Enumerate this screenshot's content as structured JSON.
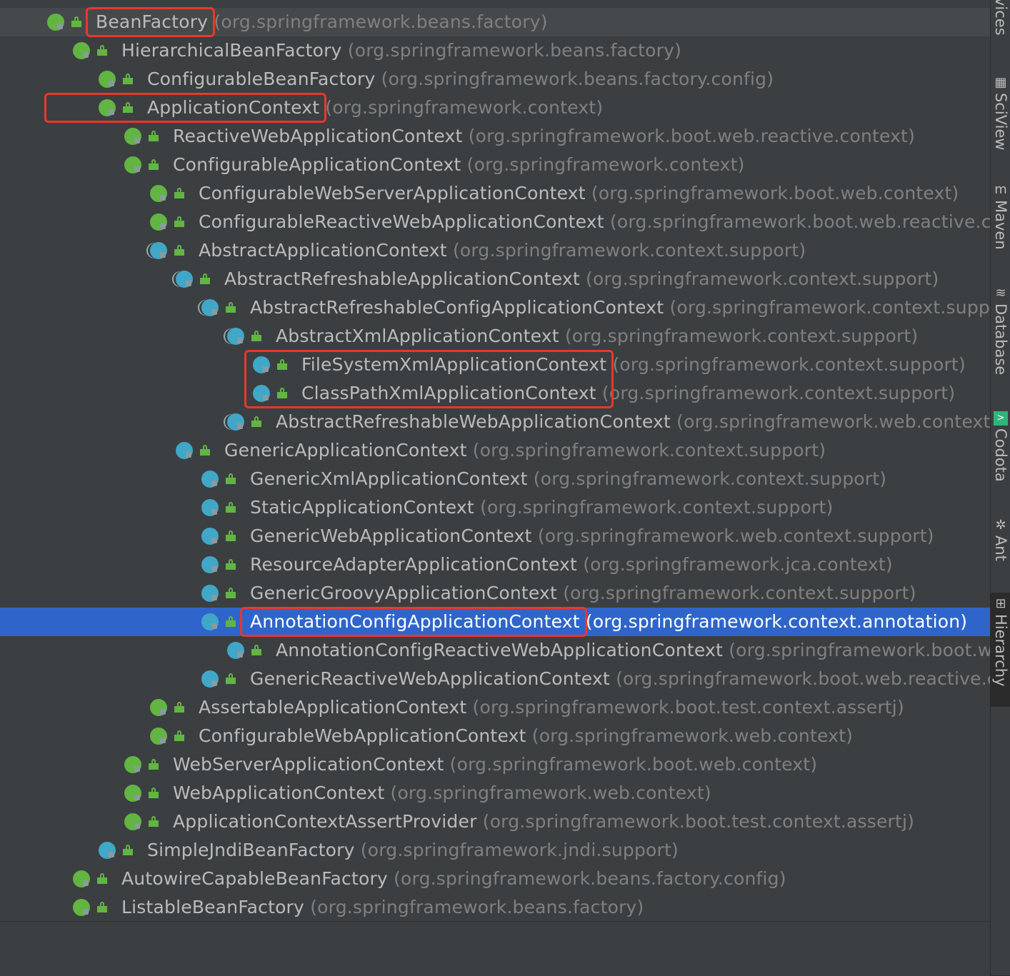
{
  "tree": [
    {
      "depth": 0,
      "arrow": "▼",
      "star": "*",
      "kind": "i",
      "name": "BeanFactory",
      "pkg": "(org.springframework.beans.factory)",
      "first": true
    },
    {
      "depth": 1,
      "arrow": "▼",
      "kind": "i",
      "name": "HierarchicalBeanFactory",
      "pkg": "(org.springframework.beans.factory)"
    },
    {
      "depth": 2,
      "arrow": "▶",
      "kind": "i",
      "name": "ConfigurableBeanFactory",
      "pkg": "(org.springframework.beans.factory.config)"
    },
    {
      "depth": 2,
      "arrow": "▼",
      "kind": "i",
      "name": "ApplicationContext",
      "pkg": "(org.springframework.context)"
    },
    {
      "depth": 3,
      "arrow": "▶",
      "kind": "i",
      "name": "ReactiveWebApplicationContext",
      "pkg": "(org.springframework.boot.web.reactive.context)"
    },
    {
      "depth": 3,
      "arrow": "▼",
      "kind": "i",
      "name": "ConfigurableApplicationContext",
      "pkg": "(org.springframework.context)"
    },
    {
      "depth": 4,
      "arrow": "▶",
      "kind": "i",
      "name": "ConfigurableWebServerApplicationContext",
      "pkg": "(org.springframework.boot.web.context)"
    },
    {
      "depth": 4,
      "arrow": "▶",
      "kind": "i",
      "name": "ConfigurableReactiveWebApplicationContext",
      "pkg": "(org.springframework.boot.web.reactive.con"
    },
    {
      "depth": 4,
      "arrow": "▼",
      "kind": "a",
      "name": "AbstractApplicationContext",
      "pkg": "(org.springframework.context.support)"
    },
    {
      "depth": 5,
      "arrow": "▼",
      "kind": "a",
      "name": "AbstractRefreshableApplicationContext",
      "pkg": "(org.springframework.context.support)"
    },
    {
      "depth": 6,
      "arrow": "▼",
      "kind": "a",
      "name": "AbstractRefreshableConfigApplicationContext",
      "pkg": "(org.springframework.context.suppor"
    },
    {
      "depth": 7,
      "arrow": "▼",
      "kind": "a",
      "name": "AbstractXmlApplicationContext",
      "pkg": "(org.springframework.context.support)"
    },
    {
      "depth": 8,
      "arrow": "",
      "kind": "c",
      "name": "FileSystemXmlApplicationContext",
      "pkg": "(org.springframework.context.support)"
    },
    {
      "depth": 8,
      "arrow": "",
      "kind": "c",
      "name": "ClassPathXmlApplicationContext",
      "pkg": "(org.springframework.context.support)"
    },
    {
      "depth": 7,
      "arrow": "▶",
      "kind": "a",
      "name": "AbstractRefreshableWebApplicationContext",
      "pkg": "(org.springframework.web.context.su"
    },
    {
      "depth": 5,
      "arrow": "▼",
      "kind": "c",
      "name": "GenericApplicationContext",
      "pkg": "(org.springframework.context.support)"
    },
    {
      "depth": 6,
      "arrow": "",
      "kind": "c",
      "name": "GenericXmlApplicationContext",
      "pkg": "(org.springframework.context.support)"
    },
    {
      "depth": 6,
      "arrow": "▶",
      "kind": "c",
      "name": "StaticApplicationContext",
      "pkg": "(org.springframework.context.support)"
    },
    {
      "depth": 6,
      "arrow": "▶",
      "kind": "c",
      "name": "GenericWebApplicationContext",
      "pkg": "(org.springframework.web.context.support)"
    },
    {
      "depth": 6,
      "arrow": "",
      "kind": "c",
      "name": "ResourceAdapterApplicationContext",
      "pkg": "(org.springframework.jca.context)"
    },
    {
      "depth": 6,
      "arrow": "",
      "kind": "c",
      "name": "GenericGroovyApplicationContext",
      "pkg": "(org.springframework.context.support)"
    },
    {
      "depth": 6,
      "arrow": "▼",
      "kind": "c",
      "name": "AnnotationConfigApplicationContext",
      "pkg": "(org.springframework.context.annotation)",
      "selected": true
    },
    {
      "depth": 7,
      "arrow": "",
      "kind": "c",
      "name": "AnnotationConfigReactiveWebApplicationContext",
      "pkg": "(org.springframework.boot.web"
    },
    {
      "depth": 6,
      "arrow": "▶",
      "kind": "c",
      "name": "GenericReactiveWebApplicationContext",
      "pkg": "(org.springframework.boot.web.reactive.co"
    },
    {
      "depth": 4,
      "arrow": "",
      "kind": "i",
      "name": "AssertableApplicationContext",
      "pkg": "(org.springframework.boot.test.context.assertj)"
    },
    {
      "depth": 4,
      "arrow": "▶",
      "kind": "i",
      "name": "ConfigurableWebApplicationContext",
      "pkg": "(org.springframework.web.context)"
    },
    {
      "depth": 3,
      "arrow": "▶",
      "kind": "i",
      "name": "WebServerApplicationContext",
      "pkg": "(org.springframework.boot.web.context)"
    },
    {
      "depth": 3,
      "arrow": "▶",
      "kind": "i",
      "name": "WebApplicationContext",
      "pkg": "(org.springframework.web.context)"
    },
    {
      "depth": 3,
      "arrow": "▶",
      "kind": "i",
      "name": "ApplicationContextAssertProvider",
      "pkg": "(org.springframework.boot.test.context.assertj)"
    },
    {
      "depth": 2,
      "arrow": "",
      "kind": "c",
      "name": "SimpleJndiBeanFactory",
      "pkg": "(org.springframework.jndi.support)"
    },
    {
      "depth": 1,
      "arrow": "▶",
      "kind": "i",
      "name": "AutowireCapableBeanFactory",
      "pkg": "(org.springframework.beans.factory.config)"
    },
    {
      "depth": 1,
      "arrow": "▶",
      "kind": "i",
      "name": "ListableBeanFactory",
      "pkg": "(org.springframework.beans.factory)"
    }
  ],
  "icon_letters": {
    "i": "I",
    "c": "C",
    "a": "C"
  },
  "highlight_rows": [
    [
      0,
      0
    ],
    [
      3,
      3
    ],
    [
      12,
      13
    ],
    [
      21,
      21
    ]
  ],
  "colors": {
    "highlight": "#e8382a",
    "selection": "#2f65ca",
    "interface": "#62b543",
    "class": "#40a7c8"
  },
  "tool_windows": [
    {
      "label": "vices",
      "icon": ""
    },
    {
      "label": "SciView",
      "icon": "▦"
    },
    {
      "label": "Maven",
      "icon": "m"
    },
    {
      "label": "Database",
      "icon": "≋"
    },
    {
      "label": "Codota",
      "icon": ">"
    },
    {
      "label": "Ant",
      "icon": "✲"
    },
    {
      "label": "Hierarchy",
      "icon": "⊞",
      "active": true
    }
  ]
}
